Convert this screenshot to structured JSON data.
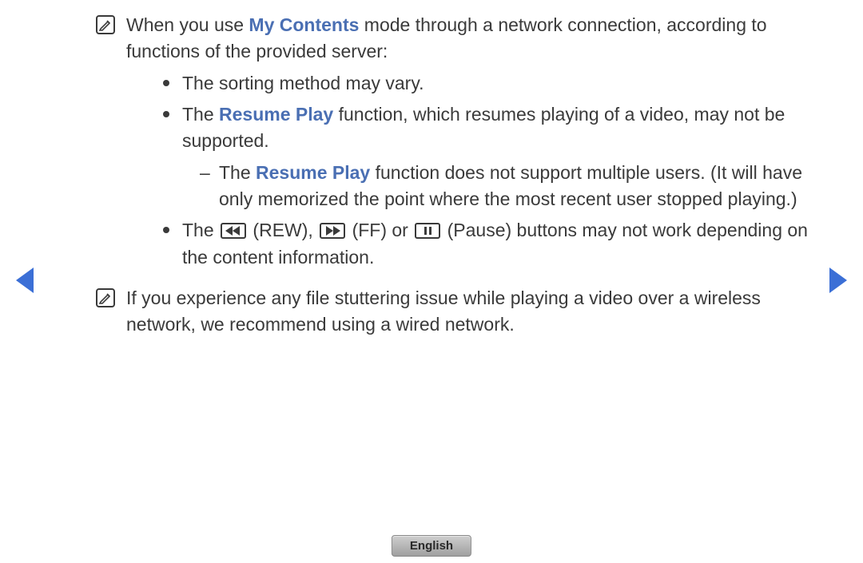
{
  "note1": {
    "pre": "When you use ",
    "highlight": "My Contents",
    "post": " mode through a network connection, according to functions of the provided server:"
  },
  "bullets": {
    "b1": "The sorting method may vary.",
    "b2": {
      "pre": "The ",
      "highlight": "Resume Play",
      "post": " function, which resumes playing of a video, may not be supported."
    },
    "b2dash": {
      "pre": "The ",
      "highlight": "Resume Play",
      "post": " function does not support multiple users. (It will have only memorized the point where the most recent user stopped playing.)"
    },
    "b3": {
      "pre": "The ",
      "rew": " (REW), ",
      "ff": " (FF) or ",
      "pause": " (Pause) buttons may not work depending on the content information."
    }
  },
  "note2": {
    "text": "If you experience any file stuttering issue while playing a video over a wireless network, we recommend using a wired network."
  },
  "footer": {
    "language": "English"
  }
}
